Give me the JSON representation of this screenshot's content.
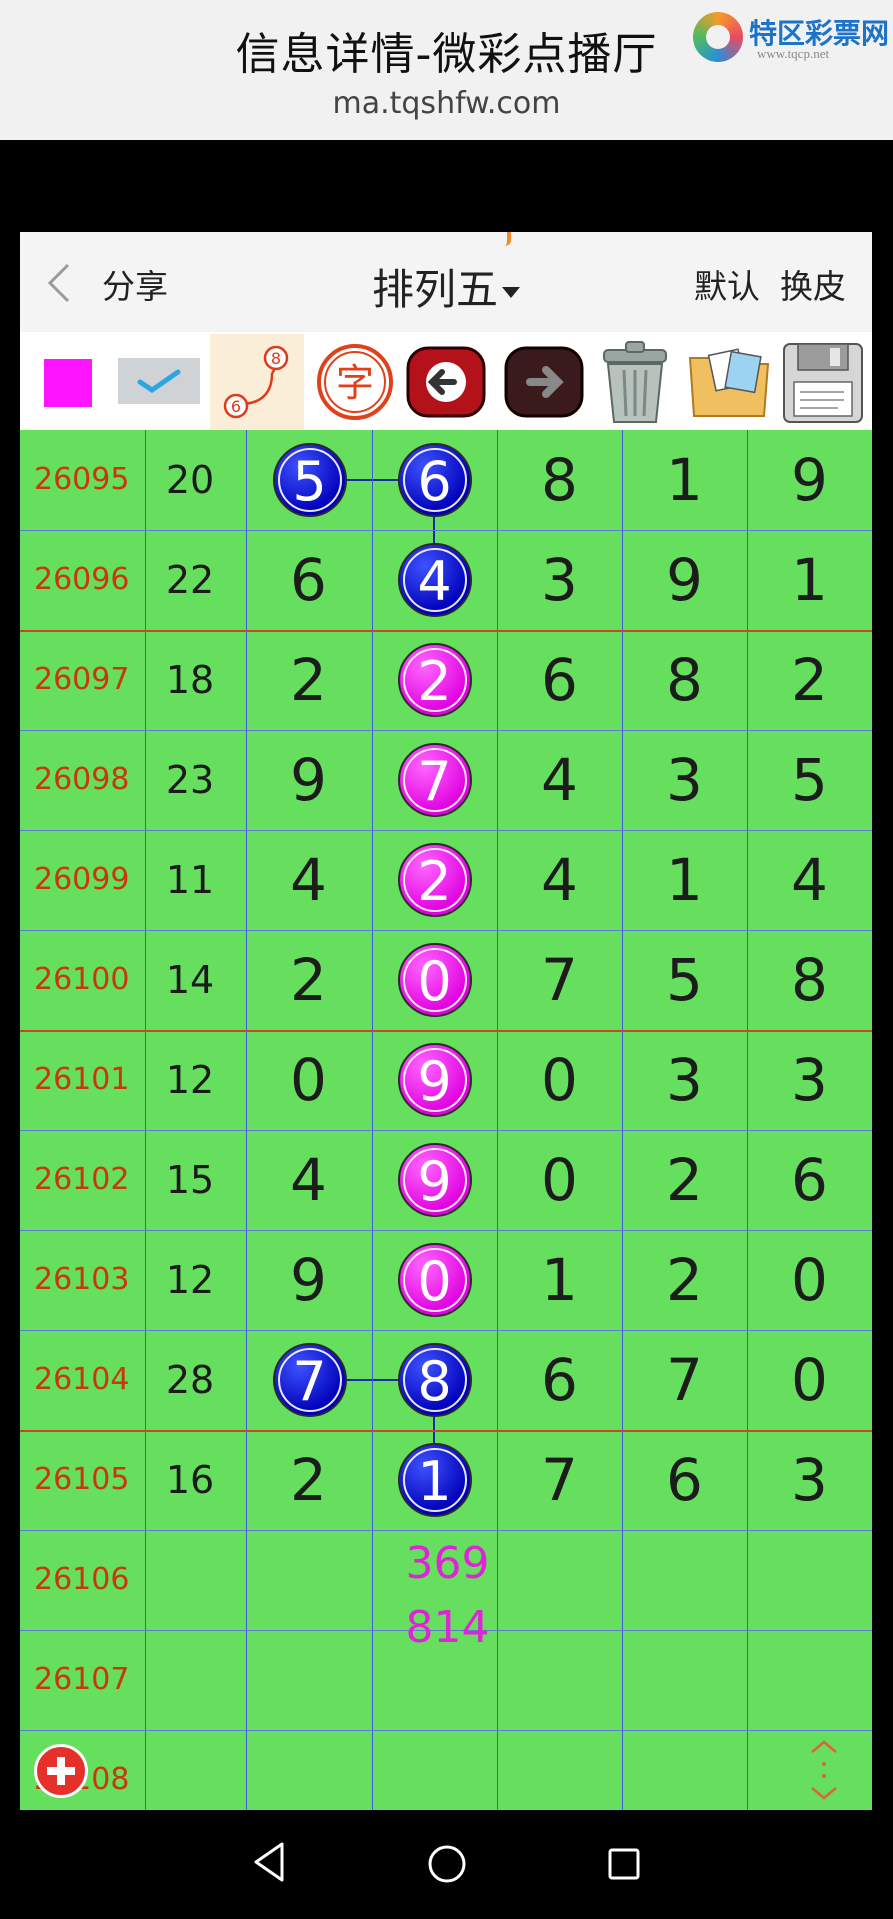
{
  "browser": {
    "title": "信息详情-微彩点播厅",
    "url": "ma.tqshfw.com",
    "logo_name": "特区彩票网",
    "logo_url": "www.tqcp.net"
  },
  "header": {
    "share_label": "分享",
    "title": "排列五",
    "default_label": "默认",
    "skin_label": "换皮"
  },
  "toolbar": {
    "route_icon_numbers": [
      "8",
      "6"
    ],
    "zi_icon_char": "字"
  },
  "colors": {
    "grid_bg": "#66df5e",
    "issue_text": "#c9380a",
    "ball_blue": "#0000d0",
    "ball_pink": "#ff20ff",
    "prediction_text": "#e022d8"
  },
  "table": {
    "rows": [
      {
        "issue": "26095",
        "sum": "20",
        "digits": [
          "5",
          "6",
          "8",
          "1",
          "9"
        ]
      },
      {
        "issue": "26096",
        "sum": "22",
        "digits": [
          "6",
          "4",
          "3",
          "9",
          "1"
        ]
      },
      {
        "issue": "26097",
        "sum": "18",
        "digits": [
          "2",
          "2",
          "6",
          "8",
          "2"
        ]
      },
      {
        "issue": "26098",
        "sum": "23",
        "digits": [
          "9",
          "7",
          "4",
          "3",
          "5"
        ]
      },
      {
        "issue": "26099",
        "sum": "11",
        "digits": [
          "4",
          "2",
          "4",
          "1",
          "4"
        ]
      },
      {
        "issue": "26100",
        "sum": "14",
        "digits": [
          "2",
          "0",
          "7",
          "5",
          "8"
        ]
      },
      {
        "issue": "26101",
        "sum": "12",
        "digits": [
          "0",
          "9",
          "0",
          "3",
          "3"
        ]
      },
      {
        "issue": "26102",
        "sum": "15",
        "digits": [
          "4",
          "9",
          "0",
          "2",
          "6"
        ]
      },
      {
        "issue": "26103",
        "sum": "12",
        "digits": [
          "9",
          "0",
          "1",
          "2",
          "0"
        ]
      },
      {
        "issue": "26104",
        "sum": "28",
        "digits": [
          "7",
          "8",
          "6",
          "7",
          "0"
        ]
      },
      {
        "issue": "26105",
        "sum": "16",
        "digits": [
          "2",
          "1",
          "7",
          "6",
          "3"
        ]
      },
      {
        "issue": "26106",
        "sum": "",
        "digits": [
          "",
          "",
          "",
          "",
          ""
        ]
      },
      {
        "issue": "26107",
        "sum": "",
        "digits": [
          "",
          "",
          "",
          "",
          ""
        ]
      },
      {
        "issue": "26108",
        "sum": "",
        "digits": [
          "",
          "",
          "",
          "",
          ""
        ]
      }
    ],
    "prediction": {
      "line1": "369",
      "line2": "814"
    }
  }
}
